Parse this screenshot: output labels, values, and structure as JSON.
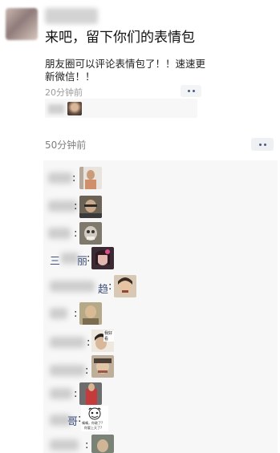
{
  "post": {
    "title": "来吧，留下你们的表情包",
    "description": "朋友圈可以评论表情包了！！速速更新微信！！",
    "time": "20分钟前"
  },
  "comment_post": {
    "time": "50分钟前"
  },
  "comments": [
    {
      "name_fragment": "",
      "colon": ":"
    },
    {
      "name_fragment": "",
      "colon": ":"
    },
    {
      "name_fragment": "",
      "colon": ":"
    },
    {
      "name_fragment": "三",
      "name_suffix": "丽",
      "colon": ":"
    },
    {
      "name_fragment": "",
      "name_suffix": "趋",
      "colon": ":"
    },
    {
      "name_fragment": "",
      "colon": ":"
    },
    {
      "name_fragment": "",
      "colon": ":"
    },
    {
      "name_fragment": "",
      "colon": ":"
    },
    {
      "name_fragment": "",
      "colon": ":"
    },
    {
      "name_fragment": "",
      "name_suffix": "哥",
      "colon": ":"
    },
    {
      "name_fragment": "",
      "colon": ":"
    }
  ],
  "sticker_texts": {
    "s7": "我好看",
    "s10_line1": "嘴嘴，你敢了?",
    "s10_line2": "你要上天了?"
  },
  "icons": {
    "more": "more-dots-icon"
  },
  "colors": {
    "name_blue": "#3d4f7c",
    "time_gray": "#9b9b9b",
    "comment_bg": "#f7f7f7"
  }
}
